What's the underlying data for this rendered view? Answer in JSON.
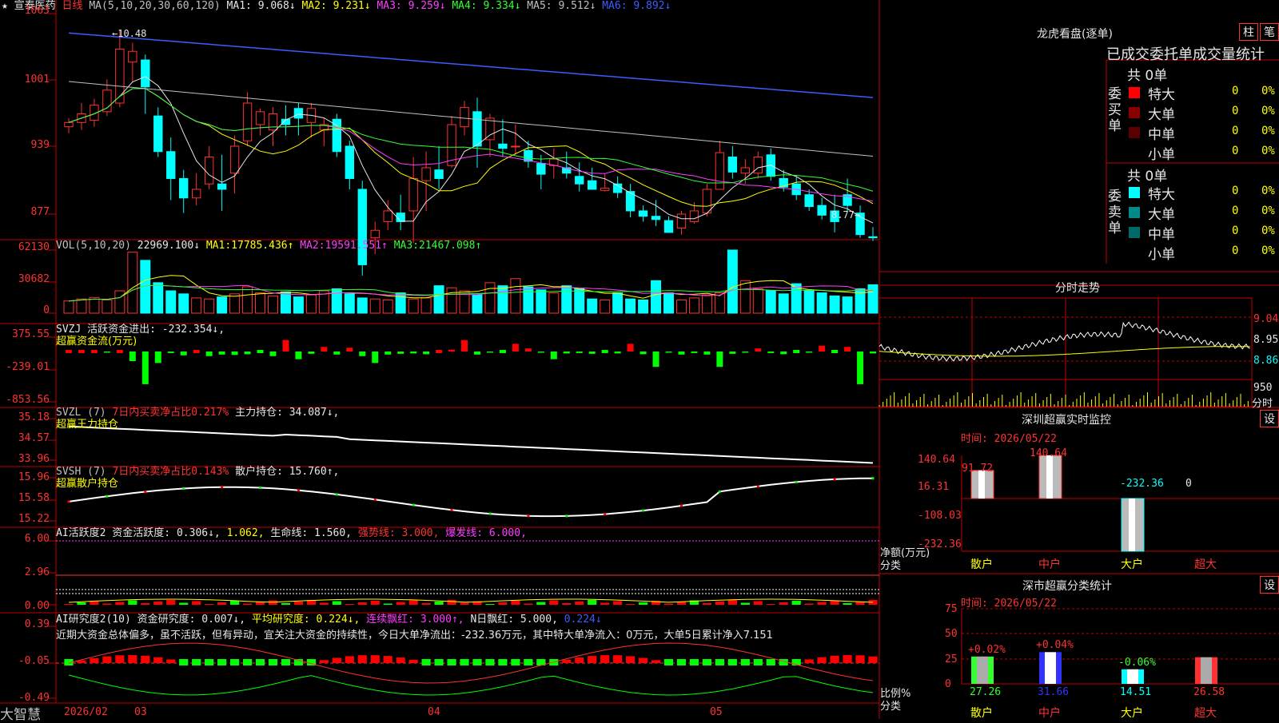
{
  "stock": {
    "name": "宣泰医药",
    "period": "日线",
    "ma_line": {
      "label": "MA(5,10,20,30,60,120)",
      "values": [
        {
          "k": "MA1:",
          "v": "9.068↓"
        },
        {
          "k": "MA2:",
          "v": "9.231↓"
        },
        {
          "k": "MA3:",
          "v": "9.259↓"
        },
        {
          "k": "MA4:",
          "v": "9.334↓"
        },
        {
          "k": "MA5:",
          "v": "9.512↓"
        },
        {
          "k": "MA6:",
          "v": "9.892↓"
        }
      ]
    },
    "high_mark": "10.48",
    "low_mark": "8.77",
    "y_labels": [
      "1063",
      "1001",
      "939",
      "877"
    ]
  },
  "vol": {
    "label": "VOL(5,10,20)",
    "cur": "22969.100↓",
    "ma": [
      {
        "k": "MA1:",
        "v": "17785.436↑"
      },
      {
        "k": "MA2:",
        "v": "19591.551↑"
      },
      {
        "k": "MA3:",
        "v": "21467.098↑"
      }
    ],
    "y_labels": [
      "62130",
      "30682",
      "0"
    ]
  },
  "svzj": {
    "line1": "SVZJ  活跃资金进出: -232.354↓,",
    "line2": "超赢资金流(万元)",
    "y_labels": [
      "375.55",
      "-239.01",
      "-853.56"
    ]
  },
  "svzl": {
    "prefix": "SVZL (7)",
    "ratio": "7日内买卖净占比0.217%",
    "hold": "主力持仓: 34.087↓,",
    "line2": "超赢王力持仓",
    "y_labels": [
      "35.18",
      "34.57",
      "33.96"
    ]
  },
  "svsh": {
    "prefix": "SVSH (7)",
    "ratio": "7日内买卖净占比0.143%",
    "hold": "散户持仓: 15.760↑,",
    "line2": "超赢散户持仓",
    "y_labels": [
      "15.96",
      "15.58",
      "15.22"
    ]
  },
  "ai2": {
    "a": "AI活跃度2 资金活跃度: 0.306↓,",
    "b": "1.062,",
    "c": "生命线: 1.560,",
    "d": "强势线: 3.000,",
    "e": "爆发线: 6.000,",
    "y_labels": [
      "6.00",
      "2.96",
      "0.00"
    ]
  },
  "ai_research": {
    "a": "AI研究度2(10) 资金研究度: 0.007↓,",
    "b": "平均研究度: 0.224↓,",
    "c": "连续飘红: 3.000↑,",
    "d": "N日飘红: 5.000,",
    "e": "0.224↓",
    "comment": "近期大资金总体偏多，虽不活跃，但有异动，宜关注大资金的持续性，今日大单净流出：-232.36万元，其中特大单净流入：0万元，大单5日累计净入7.151",
    "y_labels": [
      "0.39",
      "-0.05",
      "-0.49"
    ]
  },
  "bottom": {
    "brand": "大智慧",
    "dates": [
      "2026/02",
      "03",
      "04",
      "05"
    ]
  },
  "right": {
    "lhb_title": "龙虎看盘(逐单)",
    "btn_zhu": "柱",
    "btn_bi": "笔",
    "stat_title": "已成交委托单成交量统计",
    "buy": {
      "side": "委买单",
      "total": "共 0单",
      "rows": [
        {
          "name": "特大",
          "n": "0",
          "p": "0%",
          "color": "#ff0000"
        },
        {
          "name": "大单",
          "n": "0",
          "p": "0%",
          "color": "#8a0000"
        },
        {
          "name": "中单",
          "n": "0",
          "p": "0%",
          "color": "#5a0000"
        },
        {
          "name": "小单",
          "n": "0",
          "p": "0%",
          "color": ""
        }
      ]
    },
    "sell": {
      "side": "委卖单",
      "total": "共 0单",
      "rows": [
        {
          "name": "特大",
          "n": "0",
          "p": "0%",
          "color": "#00ffff"
        },
        {
          "name": "大单",
          "n": "0",
          "p": "0%",
          "color": "#008a8a"
        },
        {
          "name": "中单",
          "n": "0",
          "p": "0%",
          "color": "#006a6a"
        },
        {
          "name": "小单",
          "n": "0",
          "p": "0%",
          "color": ""
        }
      ]
    },
    "intraday_title": "分时走势",
    "intraday_y": [
      "9.04",
      "8.95",
      "8.86",
      "950",
      "分时"
    ],
    "sz_monitor": {
      "title": "深圳超赢实时监控",
      "set": "设",
      "time": "时间: 2026/05/22",
      "y": [
        "140.64",
        "16.31",
        "-108.03",
        "-232.36"
      ],
      "ylabel": "净额(万元)",
      "xlabel": "分类",
      "cats": [
        "散户",
        "中户",
        "大户",
        "超大"
      ],
      "vals": [
        "91.72",
        "140.64",
        "-232.36",
        "0"
      ]
    },
    "sz_class": {
      "title": "深市超赢分类统计",
      "set": "设",
      "time": "时间: 2026/05/22",
      "y": [
        "75",
        "50",
        "25",
        "0"
      ],
      "ylabel": "比例%",
      "xlabel": "分类",
      "cats": [
        "散户",
        "中户",
        "大户",
        "超大"
      ],
      "pct": [
        "27.26",
        "31.66",
        "14.51",
        "26.58"
      ],
      "chg": [
        "+0.02%",
        "+0.04%",
        "-0.06%",
        ""
      ]
    }
  },
  "chart_data": [
    {
      "type": "candlestick",
      "title": "宣泰医药 日线",
      "ohlc": [
        [
          9.58,
          9.66,
          9.52,
          9.62
        ],
        [
          9.62,
          9.8,
          9.55,
          9.7
        ],
        [
          9.64,
          9.84,
          9.58,
          9.78
        ],
        [
          9.72,
          10.02,
          9.68,
          9.92
        ],
        [
          9.8,
          10.48,
          9.76,
          10.3
        ],
        [
          10.18,
          10.36,
          10.0,
          10.28
        ],
        [
          10.2,
          10.25,
          9.7,
          9.95
        ],
        [
          9.68,
          9.76,
          9.3,
          9.35
        ],
        [
          9.35,
          9.48,
          8.9,
          9.1
        ],
        [
          9.1,
          9.18,
          8.78,
          8.92
        ],
        [
          8.92,
          9.15,
          8.85,
          9.0
        ],
        [
          9.05,
          9.4,
          9.0,
          9.3
        ],
        [
          9.05,
          9.32,
          8.8,
          9.0
        ],
        [
          9.15,
          9.5,
          8.96,
          9.4
        ],
        [
          9.45,
          9.9,
          9.4,
          9.8
        ],
        [
          9.6,
          9.75,
          9.5,
          9.72
        ],
        [
          9.55,
          9.76,
          9.4,
          9.7
        ],
        [
          9.65,
          9.78,
          9.5,
          9.6
        ],
        [
          9.75,
          9.8,
          9.5,
          9.66
        ],
        [
          9.62,
          9.8,
          9.48,
          9.75
        ],
        [
          9.55,
          9.66,
          9.4,
          9.6
        ],
        [
          9.65,
          9.7,
          9.3,
          9.35
        ],
        [
          9.4,
          9.45,
          9.0,
          9.1
        ],
        [
          9.0,
          9.08,
          8.2,
          8.3
        ],
        [
          8.55,
          8.7,
          8.4,
          8.62
        ],
        [
          8.7,
          8.9,
          8.62,
          8.8
        ],
        [
          8.78,
          8.95,
          8.62,
          8.7
        ],
        [
          8.8,
          9.3,
          8.5,
          9.1
        ],
        [
          9.08,
          9.35,
          8.8,
          9.2
        ],
        [
          9.18,
          9.4,
          9.0,
          9.1
        ],
        [
          9.22,
          9.68,
          9.2,
          9.6
        ],
        [
          9.58,
          9.82,
          9.5,
          9.76
        ],
        [
          9.72,
          9.85,
          9.2,
          9.4
        ],
        [
          9.46,
          9.7,
          9.3,
          9.66
        ],
        [
          9.42,
          9.65,
          9.3,
          9.38
        ],
        [
          9.4,
          9.6,
          9.32,
          9.4
        ],
        [
          9.36,
          9.45,
          9.2,
          9.26
        ],
        [
          9.24,
          9.32,
          9.0,
          9.14
        ],
        [
          9.22,
          9.38,
          9.1,
          9.28
        ],
        [
          9.2,
          9.35,
          9.1,
          9.15
        ],
        [
          9.12,
          9.25,
          8.98,
          9.05
        ],
        [
          9.08,
          9.2,
          9.0,
          9.0
        ],
        [
          8.99,
          9.15,
          8.98,
          9.01
        ],
        [
          9.05,
          9.12,
          8.92,
          8.97
        ],
        [
          8.98,
          9.05,
          8.74,
          8.8
        ],
        [
          8.8,
          8.85,
          8.7,
          8.75
        ],
        [
          8.75,
          8.9,
          8.66,
          8.72
        ],
        [
          8.71,
          8.75,
          8.6,
          8.6
        ],
        [
          8.64,
          8.8,
          8.58,
          8.77
        ],
        [
          8.7,
          8.88,
          8.68,
          8.8
        ],
        [
          8.78,
          9.05,
          8.75,
          9.0
        ],
        [
          9.0,
          9.45,
          9.0,
          9.34
        ],
        [
          9.3,
          9.4,
          9.1,
          9.16
        ],
        [
          9.15,
          9.28,
          9.05,
          9.2
        ],
        [
          9.15,
          9.35,
          9.1,
          9.3
        ],
        [
          9.32,
          9.38,
          9.08,
          9.12
        ],
        [
          9.1,
          9.18,
          8.98,
          9.02
        ],
        [
          9.05,
          9.12,
          8.9,
          8.95
        ],
        [
          8.95,
          9.0,
          8.8,
          8.84
        ],
        [
          8.85,
          8.92,
          8.72,
          8.76
        ],
        [
          8.8,
          8.95,
          8.6,
          8.7
        ],
        [
          8.95,
          9.1,
          8.8,
          8.85
        ],
        [
          8.78,
          8.85,
          8.55,
          8.58
        ],
        [
          8.56,
          8.65,
          8.52,
          8.55
        ]
      ],
      "ylim": [
        8.77,
        10.63
      ]
    },
    {
      "type": "bar",
      "title": "VOL(5,10,20)",
      "values": [
        12000,
        14000,
        15500,
        13000,
        22000,
        60000,
        52000,
        30000,
        22000,
        19000,
        15000,
        14000,
        16000,
        19000,
        26000,
        20000,
        17000,
        21000,
        16000,
        18000,
        22000,
        24000,
        19000,
        15000,
        14000,
        13000,
        20000,
        14000,
        15000,
        27000,
        25000,
        22000,
        18000,
        30000,
        27000,
        34000,
        26000,
        23000,
        20000,
        27000,
        24000,
        14000,
        13000,
        20000,
        14000,
        13000,
        32000,
        20000,
        13000,
        15000,
        18000,
        20000,
        62130,
        32000,
        24000,
        22000,
        19000,
        29000,
        22000,
        20000,
        17000,
        16000,
        24000,
        28000,
        23000
      ],
      "ylim": [
        0,
        62130
      ]
    },
    {
      "type": "bar",
      "title": "超赢资金流(万元)",
      "values": [
        20,
        10,
        5,
        -30,
        10,
        -250,
        -853,
        -300,
        -40,
        -100,
        10,
        -120,
        -80,
        -90,
        -70,
        -20,
        -120,
        300,
        -200,
        -60,
        120,
        -80,
        100,
        -120,
        -300,
        -80,
        -60,
        -50,
        -70,
        10,
        50,
        300,
        -80,
        -30,
        -20,
        200,
        80,
        -30,
        -200,
        -50,
        -40,
        -60,
        -20,
        -50,
        200,
        -70,
        -400,
        -30,
        -80,
        -40,
        -80,
        -400,
        -60,
        -30,
        80,
        -40,
        -70,
        -20,
        -30,
        150,
        -20,
        120,
        -860,
        -50,
        -120,
        -30,
        -50,
        80,
        60,
        -232
      ],
      "ylim": [
        -853.56,
        375.55
      ]
    }
  ]
}
